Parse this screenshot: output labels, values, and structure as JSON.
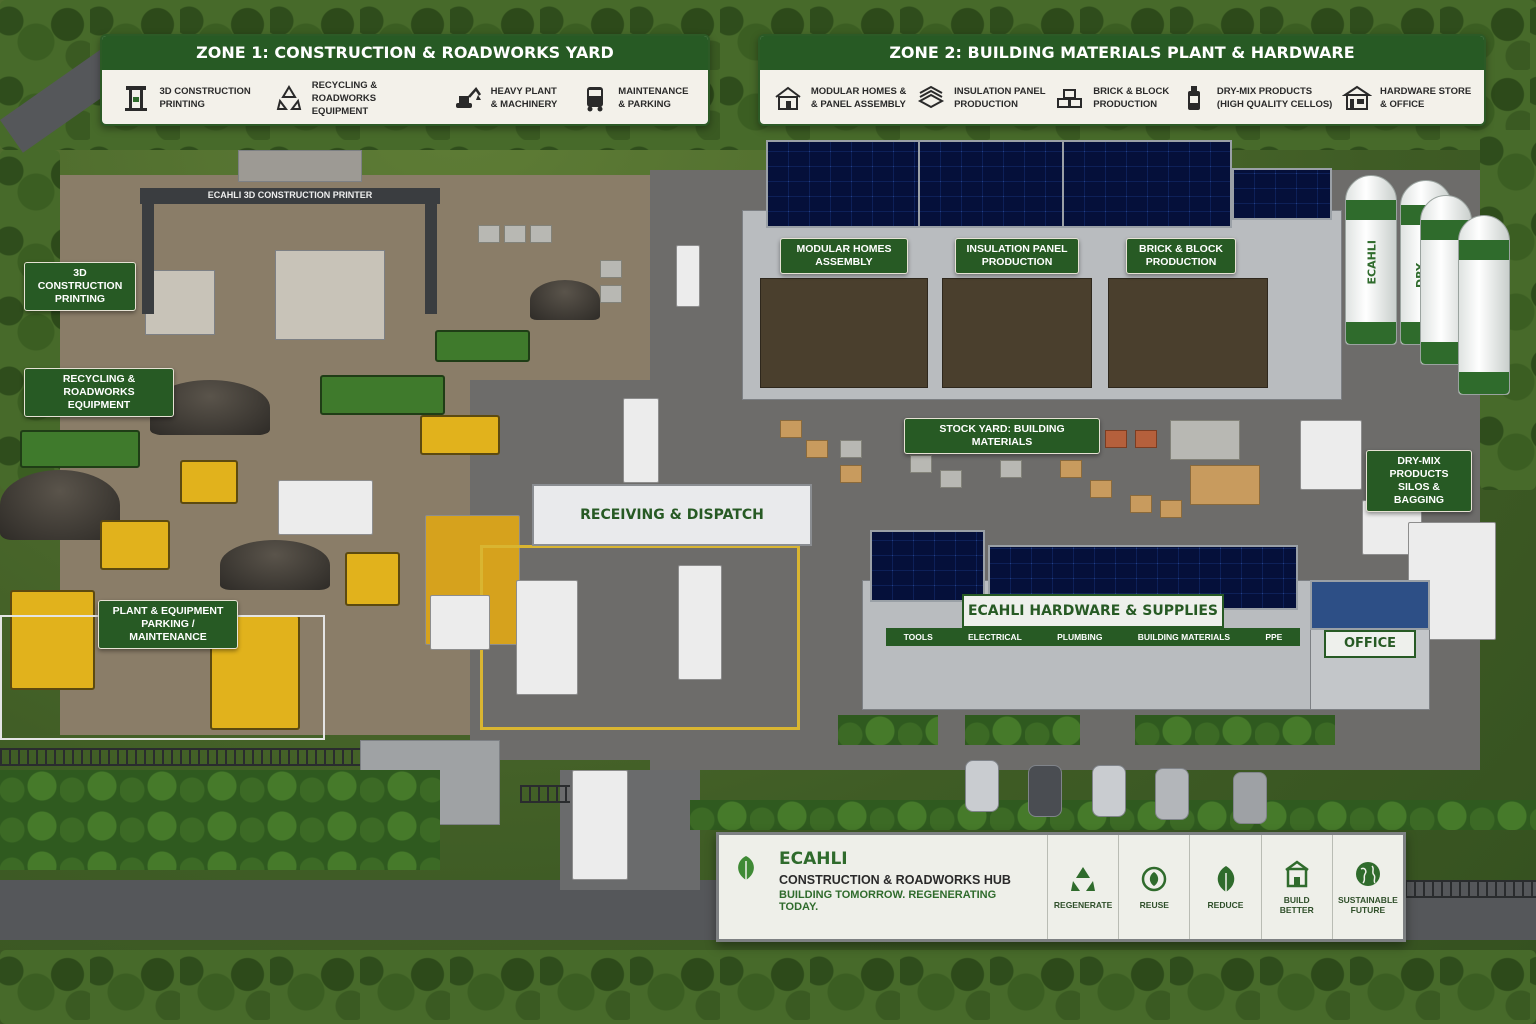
{
  "zone1": {
    "title": "ZONE 1: CONSTRUCTION & ROADWORKS YARD",
    "items": [
      {
        "icon": "printer-gantry-icon",
        "line1": "3D CONSTRUCTION",
        "line2": "PRINTING"
      },
      {
        "icon": "recycle-icon",
        "line1": "RECYCLING &",
        "line2": "ROADWORKS EQUIPMENT"
      },
      {
        "icon": "excavator-icon",
        "line1": "HEAVY PLANT",
        "line2": "& MACHINERY"
      },
      {
        "icon": "vehicle-icon",
        "line1": "MAINTENANCE",
        "line2": "& PARKING"
      }
    ]
  },
  "zone2": {
    "title": "ZONE 2: BUILDING MATERIALS PLANT & HARDWARE",
    "items": [
      {
        "icon": "house-icon",
        "line1": "MODULAR HOMES &",
        "line2": "& PANEL ASSEMBLY"
      },
      {
        "icon": "panel-icon",
        "line1": "INSULATION PANEL",
        "line2": "PRODUCTION"
      },
      {
        "icon": "bricks-icon",
        "line1": "BRICK & BLOCK",
        "line2": "PRODUCTION"
      },
      {
        "icon": "bottle-icon",
        "line1": "DRY-MIX PRODUCTS",
        "line2": "(HIGH QUALITY CELLOS)"
      },
      {
        "icon": "store-icon",
        "line1": "HARDWARE STORE",
        "line2": "& OFFICE"
      }
    ]
  },
  "labels": {
    "printer_gantry": "ECAHLI 3D CONSTRUCTION PRINTER",
    "printing": [
      "3D CONSTRUCTION",
      "PRINTING"
    ],
    "recycling": [
      "RECYCLING & ROADWORKS",
      "EQUIPMENT"
    ],
    "parking": [
      "PLANT & EQUIPMENT",
      "PARKING / MAINTENANCE"
    ],
    "modular": [
      "MODULAR HOMES",
      "ASSEMBLY"
    ],
    "insulation": [
      "INSULATION PANEL",
      "PRODUCTION"
    ],
    "brick": [
      "BRICK & BLOCK",
      "PRODUCTION"
    ],
    "stock_yard": "STOCK YARD: BUILDING MATERIALS",
    "receiving": "RECEIVING & DISPATCH",
    "drymix": [
      "DRY-MIX PRODUCTS",
      "SILOS & BAGGING"
    ],
    "silo_brand": "ECAHLI",
    "silo_product": "DRY-MIX"
  },
  "store": {
    "sign": "ECAHLI HARDWARE & SUPPLIES",
    "departments": [
      "TOOLS",
      "ELECTRICAL",
      "PLUMBING",
      "BUILDING MATERIALS",
      "PPE"
    ],
    "office": "OFFICE"
  },
  "billboard": {
    "brand": "ECAHLI",
    "subtitle": "CONSTRUCTION & ROADWORKS HUB",
    "tagline": "BUILDING TOMORROW. REGENERATING TODAY.",
    "pillars": [
      {
        "icon": "recycle-icon",
        "label": "REGENERATE"
      },
      {
        "icon": "reuse-leaf-icon",
        "label": "REUSE"
      },
      {
        "icon": "leaf-icon",
        "label": "REDUCE"
      },
      {
        "icon": "building-icon",
        "label": "BUILD BETTER"
      },
      {
        "icon": "globe-icon",
        "label": "SUSTAINABLE FUTURE"
      }
    ]
  },
  "colors": {
    "brand_green": "#275a24",
    "machine_yellow": "#e1b21c",
    "solar_blue": "#23407a"
  }
}
